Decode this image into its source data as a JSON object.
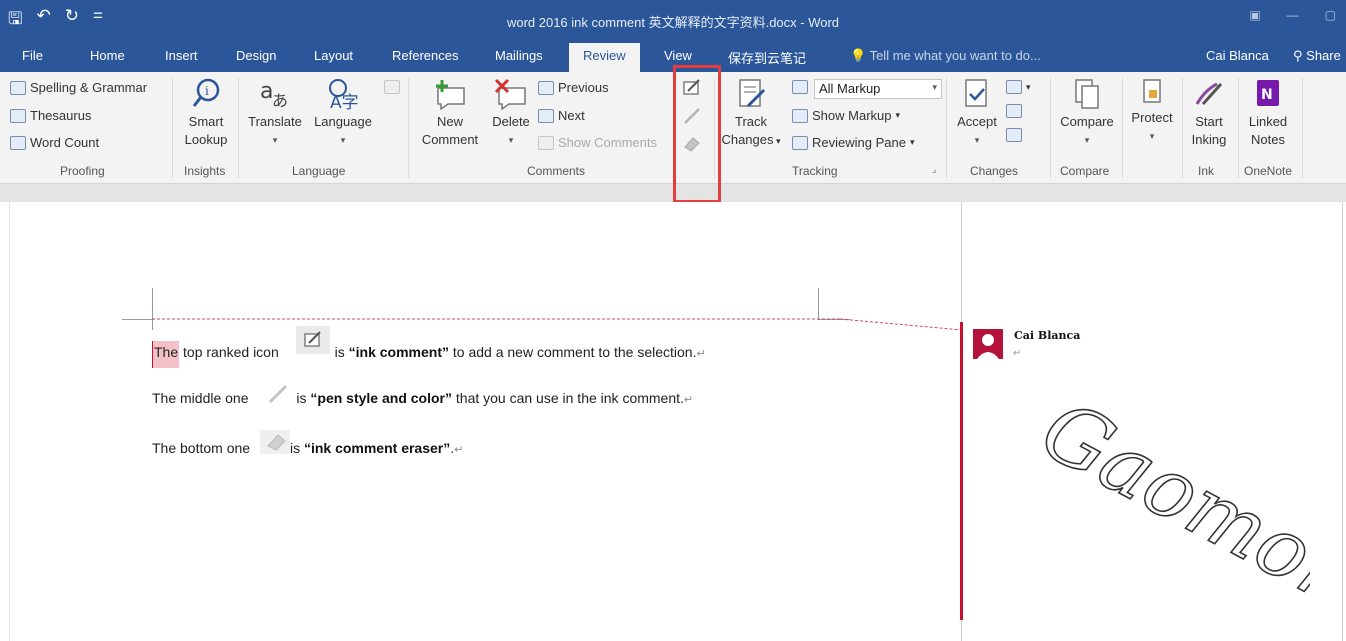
{
  "window": {
    "title": "word 2016 ink comment 英文解释的文字资料.docx - Word",
    "qat": [
      "🖫",
      "↶",
      "↻",
      "="
    ]
  },
  "tabs": {
    "items": [
      "File",
      "Home",
      "Insert",
      "Design",
      "Layout",
      "References",
      "Mailings",
      "Review",
      "View",
      "保存到云笔记"
    ],
    "active": "Review",
    "tell_me": "Tell me what you want to do...",
    "user": "Cai Blanca",
    "share": "Share"
  },
  "proofing": {
    "spelling": "Spelling & Grammar",
    "thesaurus": "Thesaurus",
    "word_count": "Word Count",
    "label": "Proofing"
  },
  "insights": {
    "smart": "Smart",
    "lookup": "Lookup",
    "label": "Insights"
  },
  "language": {
    "translate": "Translate",
    "language": "Language",
    "label": "Language"
  },
  "comments": {
    "new1": "New",
    "new2": "Comment",
    "delete": "Delete",
    "previous": "Previous",
    "next": "Next",
    "show_comments": "Show Comments",
    "label": "Comments"
  },
  "tracking": {
    "track1": "Track",
    "track2": "Changes",
    "all_markup": "All Markup",
    "show_markup": "Show Markup",
    "reviewing_pane": "Reviewing Pane",
    "label": "Tracking"
  },
  "changes": {
    "accept": "Accept",
    "label": "Changes"
  },
  "compare": {
    "compare": "Compare",
    "label": "Compare"
  },
  "protect": {
    "protect": "Protect"
  },
  "ink": {
    "start1": "Start",
    "start2": "Inking",
    "label": "Ink"
  },
  "onenote": {
    "linked1": "Linked",
    "linked2": "Notes",
    "label": "OneNote"
  },
  "document": {
    "line1": {
      "highlighted": "The",
      "pre": " top ranked icon",
      "mid": " is ",
      "bold": "“ink comment”",
      "post": " to add a new comment to the selection."
    },
    "line2": {
      "pre": "The middle one",
      "mid": " is ",
      "bold": "“pen style and color”",
      "post": " that you can use in the ink comment."
    },
    "line3": {
      "pre": "The bottom one",
      "mid": " is ",
      "bold": "“ink comment eraser”",
      "post": "."
    },
    "pilcrow": "↵"
  },
  "comment": {
    "author": "Cai Blanca",
    "ink_text": "Gaomon"
  },
  "colors": {
    "accent": "#2b579a",
    "highlight_box": "#e43d3d",
    "comment_bar": "#c8102e"
  }
}
